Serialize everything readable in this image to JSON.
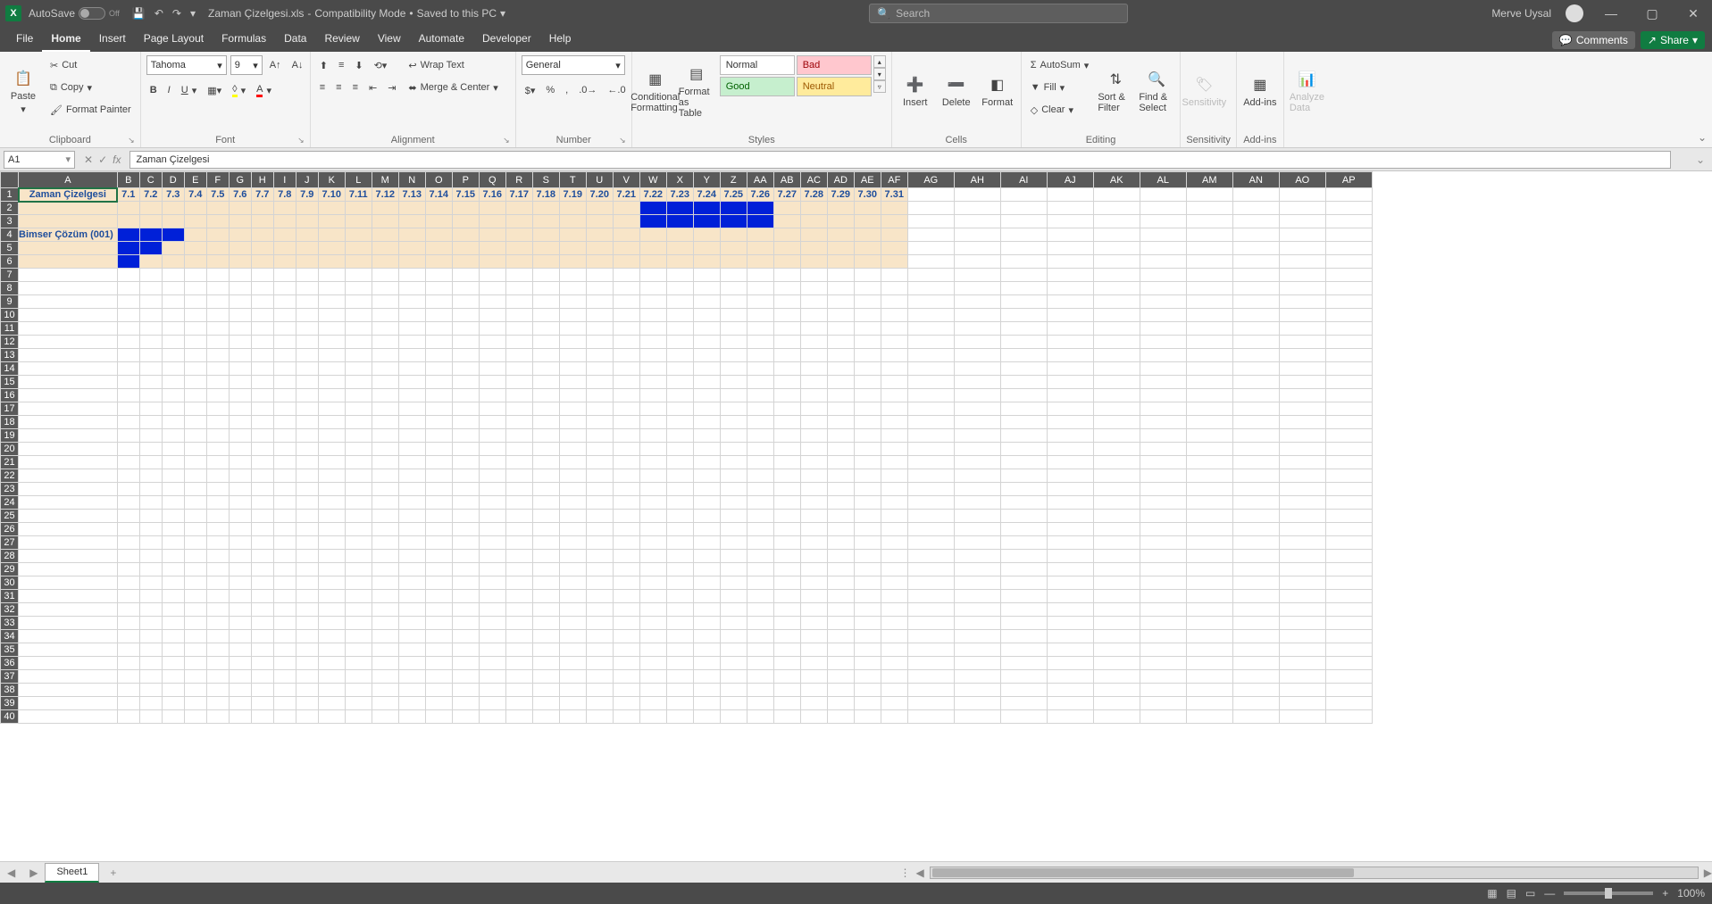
{
  "titlebar": {
    "autosave_label": "AutoSave",
    "autosave_state": "Off",
    "filename": "Zaman Çizelgesi.xls",
    "mode": "Compatibility Mode",
    "saved_status": "Saved to this PC",
    "search_placeholder": "Search",
    "user_name": "Merve Uysal"
  },
  "tabs": {
    "items": [
      "File",
      "Home",
      "Insert",
      "Page Layout",
      "Formulas",
      "Data",
      "Review",
      "View",
      "Automate",
      "Developer",
      "Help"
    ],
    "active": "Home",
    "comments": "Comments",
    "share": "Share"
  },
  "ribbon": {
    "clipboard": {
      "label": "Clipboard",
      "paste": "Paste",
      "cut": "Cut",
      "copy": "Copy",
      "format_painter": "Format Painter"
    },
    "font": {
      "label": "Font",
      "name": "Tahoma",
      "size": "9"
    },
    "alignment": {
      "label": "Alignment",
      "wrap": "Wrap Text",
      "merge": "Merge & Center"
    },
    "number": {
      "label": "Number",
      "format": "General"
    },
    "styles": {
      "label": "Styles",
      "conditional": "Conditional Formatting",
      "table": "Format as Table",
      "normal": "Normal",
      "bad": "Bad",
      "good": "Good",
      "neutral": "Neutral"
    },
    "cells": {
      "label": "Cells",
      "insert": "Insert",
      "delete": "Delete",
      "format": "Format"
    },
    "editing": {
      "label": "Editing",
      "autosum": "AutoSum",
      "fill": "Fill",
      "clear": "Clear",
      "sort": "Sort & Filter",
      "find": "Find & Select"
    },
    "sensitivity": {
      "label": "Sensitivity",
      "btn": "Sensitivity"
    },
    "addins": {
      "label": "Add-ins",
      "btn": "Add-ins"
    },
    "analyze": {
      "btn": "Analyze Data"
    }
  },
  "namebox": "A1",
  "formula_value": "Zaman Çizelgesi",
  "columns": [
    "A",
    "B",
    "C",
    "D",
    "E",
    "F",
    "G",
    "H",
    "I",
    "J",
    "K",
    "L",
    "M",
    "N",
    "O",
    "P",
    "Q",
    "R",
    "S",
    "T",
    "U",
    "V",
    "W",
    "X",
    "Y",
    "Z",
    "AA",
    "AB",
    "AC",
    "AD",
    "AE",
    "AF",
    "AG",
    "AH",
    "AI",
    "AJ",
    "AK",
    "AL",
    "AM",
    "AN",
    "AO",
    "AP"
  ],
  "row_count": 40,
  "sheet": {
    "title": "Zaman Çizelgesi",
    "dates": [
      "7.1",
      "7.2",
      "7.3",
      "7.4",
      "7.5",
      "7.6",
      "7.7",
      "7.8",
      "7.9",
      "7.10",
      "7.11",
      "7.12",
      "7.13",
      "7.14",
      "7.15",
      "7.16",
      "7.17",
      "7.18",
      "7.19",
      "7.20",
      "7.21",
      "7.22",
      "7.23",
      "7.24",
      "7.25",
      "7.26",
      "7.27",
      "7.28",
      "7.29",
      "7.30",
      "7.31"
    ],
    "task_name": "Bimser Çözüm (001)",
    "fills": {
      "2": [
        22,
        23,
        24,
        25,
        26
      ],
      "3": [
        22,
        23,
        24,
        25,
        26
      ],
      "4": [
        1,
        2,
        3
      ],
      "5": [
        1,
        2
      ],
      "6": [
        1
      ]
    },
    "buff_rows": [
      2,
      3,
      4,
      5,
      6
    ]
  },
  "sheet_tab": "Sheet1",
  "zoom": "100%"
}
